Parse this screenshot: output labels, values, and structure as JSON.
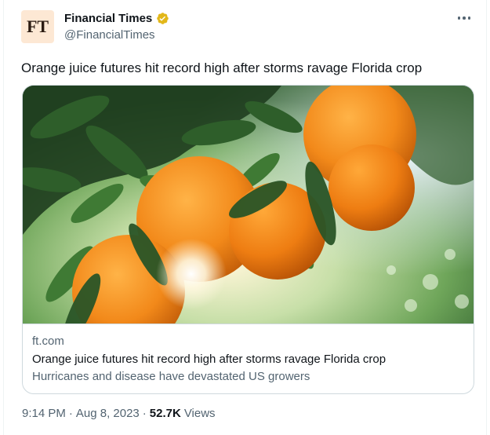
{
  "author": {
    "avatar_text": "FT",
    "display_name": "Financial Times",
    "handle": "@FinancialTimes",
    "verified_badge_color": "#e2b719",
    "avatar_bg": "#fde8d4"
  },
  "menu": {
    "icon": "more-horizontal-icon"
  },
  "tweet": {
    "text": "Orange juice futures hit record high after storms ravage Florida crop"
  },
  "link_card": {
    "image": "orange-tree-photo",
    "domain": "ft.com",
    "title": "Orange juice futures hit record high after storms ravage Florida crop",
    "description": "Hurricanes and disease have devastated US growers"
  },
  "footer": {
    "time": "9:14 PM",
    "separator": "·",
    "date": "Aug 8, 2023",
    "views_count": "52.7K",
    "views_label": "Views"
  }
}
